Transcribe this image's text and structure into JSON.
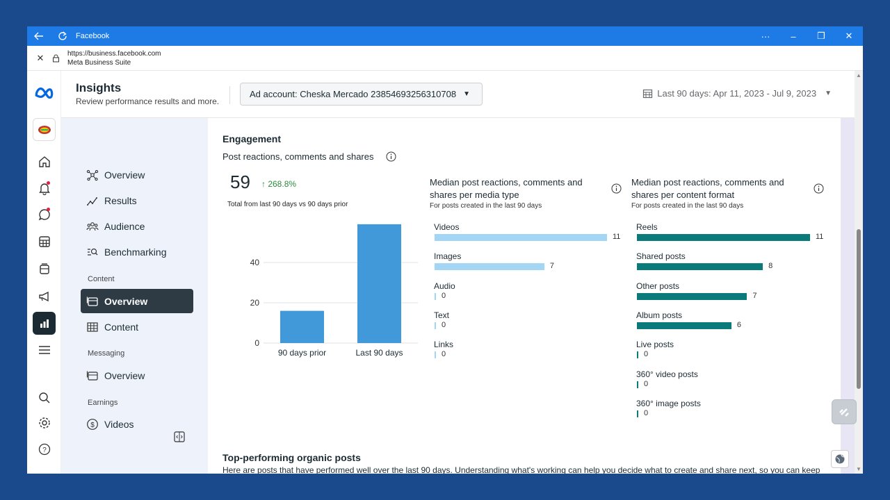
{
  "titlebar": {
    "title": "Facebook",
    "more": "···",
    "minimize": "–",
    "restore": "❐",
    "close": "✕"
  },
  "address": {
    "close": "✕",
    "url": "https://business.facebook.com",
    "site_name": "Meta Business Suite"
  },
  "rail": {
    "icons": [
      "meta-logo-icon",
      "business-avatar-icon",
      "home-icon",
      "notifications-icon",
      "messages-icon",
      "table-icon",
      "pages-icon",
      "ads-megaphone-icon",
      "insights-chart-icon",
      "menu-icon",
      "search-icon",
      "settings-icon",
      "help-icon"
    ]
  },
  "header": {
    "title": "Insights",
    "subtitle": "Review performance results and more.",
    "ad_account": "Ad account: Cheska Mercado 23854693256310708",
    "date_range": "Last 90 days: Apr 11, 2023 - Jul 9, 2023"
  },
  "sidebar": {
    "items": [
      {
        "label": "Overview",
        "icon": "overview-network-icon"
      },
      {
        "label": "Results",
        "icon": "results-trend-icon"
      },
      {
        "label": "Audience",
        "icon": "audience-icon"
      },
      {
        "label": "Benchmarking",
        "icon": "benchmarking-icon"
      }
    ],
    "section_content": "Content",
    "content_items": [
      {
        "label": "Overview",
        "icon": "content-overview-icon",
        "active": true
      },
      {
        "label": "Content",
        "icon": "content-table-icon"
      }
    ],
    "section_messaging": "Messaging",
    "messaging_items": [
      {
        "label": "Overview",
        "icon": "messaging-overview-icon"
      }
    ],
    "section_earnings": "Earnings",
    "earnings_items": [
      {
        "label": "Videos",
        "icon": "dollar-icon"
      }
    ]
  },
  "engagement": {
    "title": "Engagement",
    "card1": {
      "title": "Post reactions, comments and shares",
      "value": "59",
      "delta": "↑ 268.8%",
      "note": "Total from last 90 days vs 90 days prior"
    },
    "card2": {
      "title_line1": "Median post reactions, comments and",
      "title_line2": "shares per media type",
      "subtitle": "For posts created in the last 90 days"
    },
    "card3": {
      "title_line1": "Median post reactions, comments and",
      "title_line2": "shares per content format",
      "subtitle": "For posts created in the last 90 days"
    }
  },
  "chart_data": [
    {
      "type": "bar",
      "categories": [
        "90 days prior",
        "Last 90 days"
      ],
      "values": [
        16,
        59
      ],
      "ylim": [
        0,
        60
      ],
      "yticks": [
        0,
        20,
        40
      ],
      "color": "#4299d9",
      "grid": true
    },
    {
      "type": "bar",
      "orientation": "horizontal",
      "categories": [
        "Videos",
        "Images",
        "Audio",
        "Text",
        "Links"
      ],
      "values": [
        11,
        7,
        0,
        0,
        0
      ],
      "color": "#a3d6f5"
    },
    {
      "type": "bar",
      "orientation": "horizontal",
      "categories": [
        "Reels",
        "Shared posts",
        "Other posts",
        "Album posts",
        "Live posts",
        "360° video posts",
        "360° image posts"
      ],
      "values": [
        11,
        8,
        7,
        6,
        0,
        0,
        0
      ],
      "color": "#0a7a7a"
    }
  ],
  "top_posts": {
    "title": "Top-performing organic posts",
    "description": "Here are posts that have performed well over the last 90 days. Understanding what's working can help you decide what to create and share next, so you can keep up the great work."
  }
}
